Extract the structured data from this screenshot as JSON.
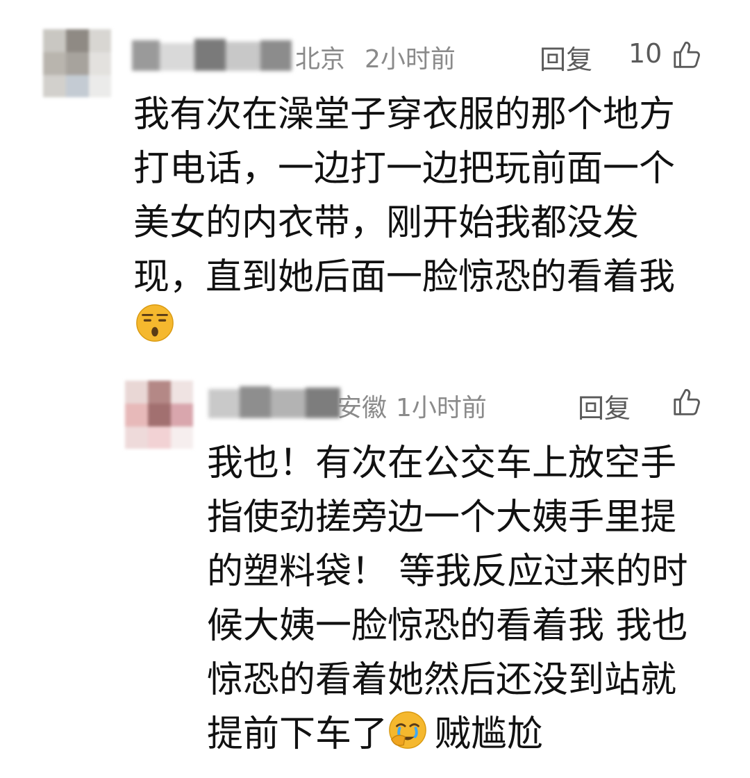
{
  "comments": [
    {
      "location": "北京",
      "time": "2小时前",
      "reply_label": "回复",
      "like_count": "10",
      "lines": [
        "我有次在澡堂子穿衣服的那个地方",
        "打电话，一边打一边把玩前面一个",
        "美女的内衣带，刚开始我都没发",
        "现，直到她后面一脸惊恐的看着我"
      ],
      "trailing_emoji": "shocked-face-emoji"
    },
    {
      "location": "安徽",
      "time": "1小时前",
      "reply_label": "回复",
      "like_count": "",
      "lines": [
        "我也！有次在公交车上放空手",
        "指使劲搓旁边一个大姨手里提",
        "的塑料袋！ 等我反应过来的时",
        "候大姨一脸惊恐的看着我 我也",
        "惊恐的看着她然后还没到站就"
      ],
      "last_line_prefix": "提前下车了",
      "last_line_suffix": "贼尴尬",
      "inline_emoji": "facepalm-crying-emoji"
    }
  ],
  "colors": {
    "text": "#111111",
    "meta": "#8a8a8a",
    "action": "#5a5a5a",
    "emoji_yellow": "#f5b82e"
  }
}
